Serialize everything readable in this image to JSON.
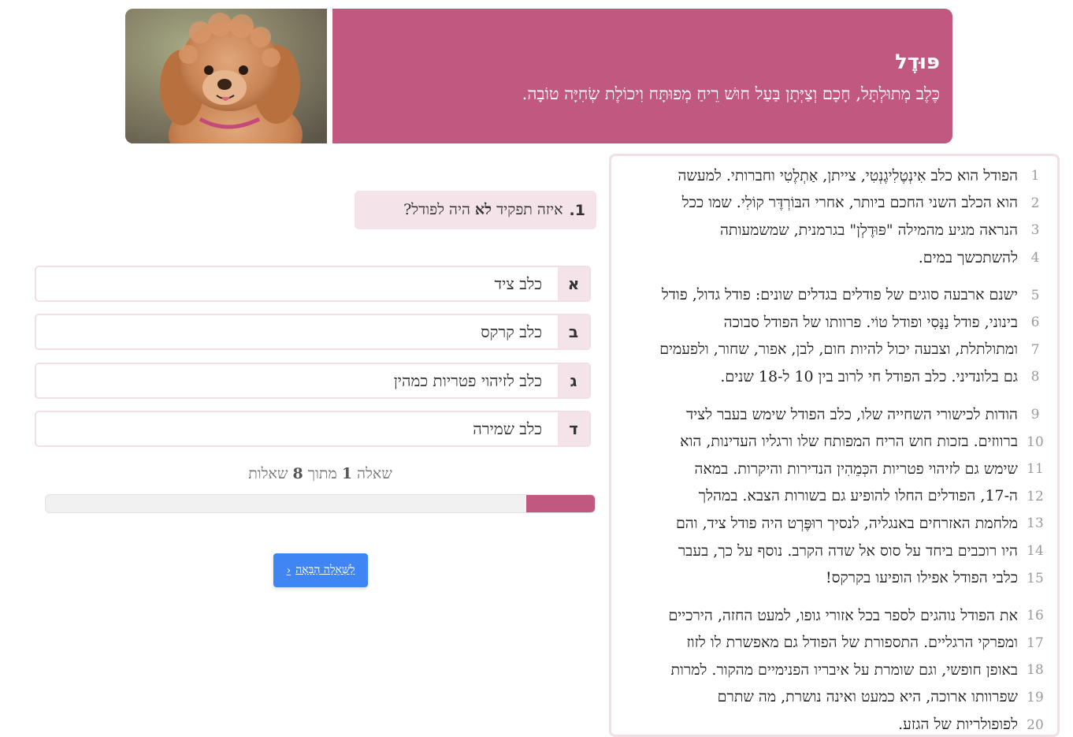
{
  "header": {
    "title": "פּוּדֶל",
    "subtitle": "כֶּלֶב מְתוּלְתָּל, חָכָם וְצַיְּתָן בַּעַל חוּשׁ רֵיחַ מְפוּתָּח וִיכוֹלֶת שְׂחִיָּה טוֹבָה.",
    "photo": "poodle-dog-photo"
  },
  "reading": {
    "paragraphs": [
      {
        "lines": [
          {
            "n": "1",
            "t": "הפודל הוא כלב אִינְטֶלִיגֶנְטִי, צייתן, אַתְלֶטִי וחברותי. למעשה"
          },
          {
            "n": "2",
            "t": "הוא הכלב השני החכם ביותר, אחרי הבּוֹרְדֶּר קוֹלִי. שמו ככל"
          },
          {
            "n": "3",
            "t": "הנראה מגיע מהמילה \"פּוּדֶלְן\" בגרמנית, שמשמעותה"
          },
          {
            "n": "4",
            "t": "להשתכשך במים."
          }
        ]
      },
      {
        "lines": [
          {
            "n": "5",
            "t": "ישנם ארבעה סוגים של פודלים בגדלים שונים: פודל גדול, פודל"
          },
          {
            "n": "6",
            "t": "בינוני, פודל נַנָּסִי ופודל טוֹי. פרוותו של הפודל סבוכה"
          },
          {
            "n": "7",
            "t": "ומתולתלת, וצבעה יכול להיות חום, לבן, אפור, שחור, ולפעמים"
          },
          {
            "n": "8",
            "t": "גם בלונדיני. כלב הפודל חי לרוב בין 10 ל-18 שנים."
          }
        ]
      },
      {
        "lines": [
          {
            "n": "9",
            "t": "הודות לכישורי השחייה שלו, כלב הפודל שימש בעבר לציד"
          },
          {
            "n": "10",
            "t": "ברווזים. בזכות חוש הריח המפותח שלו ורגליו העדינות, הוא"
          },
          {
            "n": "11",
            "t": "שימש גם לזיהוי פטריות הכְּמֵהִין הנדירות והיקרות. במאה"
          },
          {
            "n": "12",
            "t": "ה-17, הפודלים החלו להופיע גם בשורות הצבא. במהלך"
          },
          {
            "n": "13",
            "t": "מלחמת האזרחים באנגליה, לנסיך רוּפֶּרְט היה פודל ציד, והם"
          },
          {
            "n": "14",
            "t": "היו רוכבים ביחד על סוס אל שדה הקרב. נוסף על כך, בעבר"
          },
          {
            "n": "15",
            "t": "כלבי הפודל אפילו הופיעו בקרקס!"
          }
        ]
      },
      {
        "lines": [
          {
            "n": "16",
            "t": "את הפודל נוהגים לספר בכל אזורי גופו, למעט החזה, הירכיים"
          },
          {
            "n": "17",
            "t": "ומפרקי הרגליים. התספורת של הפודל גם מאפשרת לו לזוז"
          },
          {
            "n": "18",
            "t": "באופן חופשי, וגם שומרת על איבריו הפנימיים מהקור. למרות"
          },
          {
            "n": "19",
            "t": "שפרוותו ארוכה, היא כמעט ואינה נושרת, מה שתרם"
          },
          {
            "n": "20",
            "t": "לפופולריות של הגזע."
          }
        ]
      }
    ]
  },
  "question": {
    "number": "1.",
    "pre": "איזה תפקיד",
    "emph": "לא",
    "post": "היה לפודל?"
  },
  "answers": [
    {
      "letter": "א",
      "text": "כלב ציד"
    },
    {
      "letter": "ב",
      "text": "כלב קרקס"
    },
    {
      "letter": "ג",
      "text": "כלב לזיהוי פטריות כמהין"
    },
    {
      "letter": "ד",
      "text": "כלב שמירה"
    }
  ],
  "progress": {
    "word_question": "שאלה",
    "current": "1",
    "word_of": "מתוך",
    "total": "8",
    "word_questions": "שאלות",
    "fraction": 0.125,
    "accent": "#c0587f"
  },
  "next_button": {
    "label": "לַשְּׁאֵלָה הַבָּאָה",
    "icon": "chevron-left-icon"
  }
}
